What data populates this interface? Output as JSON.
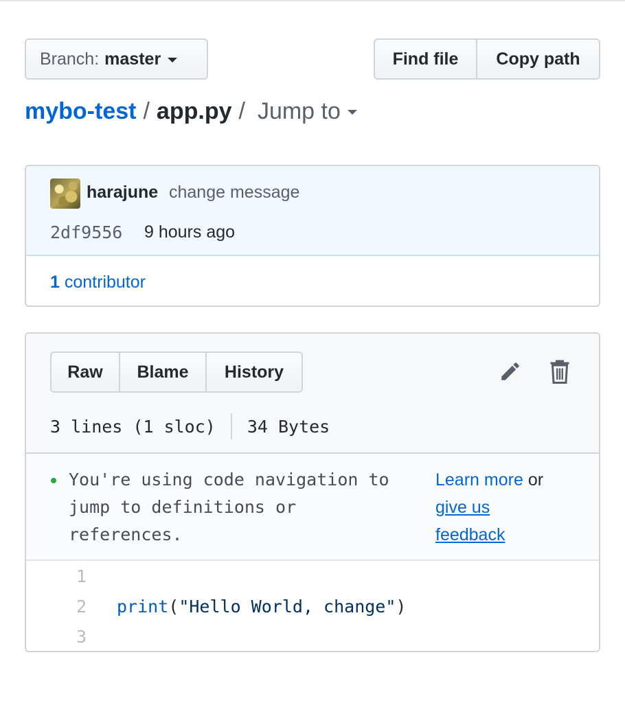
{
  "branch": {
    "prefix": "Branch:",
    "name": "master"
  },
  "file_actions": {
    "find_file": "Find file",
    "copy_path": "Copy path"
  },
  "breadcrumb": {
    "repo": "mybo-test",
    "separator": "/",
    "file": "app.py",
    "jump_to": "Jump to"
  },
  "commit": {
    "author": "harajune",
    "message": "change message",
    "sha": "2df9556",
    "time": "9 hours ago"
  },
  "contributors": {
    "count": "1",
    "label": "contributor"
  },
  "file_view": {
    "raw": "Raw",
    "blame": "Blame",
    "history": "History"
  },
  "file_info": {
    "lines": "3 lines (1 sloc)",
    "size": "34 Bytes"
  },
  "notice": {
    "text": "You're using code navigation to jump to definitions or references.",
    "learn_more": "Learn more",
    "or": "or",
    "give_us": "give us",
    "feedback": "feedback"
  },
  "code": {
    "lines": [
      {
        "num": "1",
        "text": ""
      },
      {
        "num": "2",
        "fn": "print",
        "open": "(",
        "str": "\"Hello World, change\"",
        "close": ")"
      },
      {
        "num": "3",
        "text": ""
      }
    ]
  },
  "colors": {
    "link": "#0366d6",
    "commit_bg": "#f1f8ff",
    "header_bg": "#f6f8fa",
    "dot": "#28a745"
  },
  "icons": {
    "edit": "pencil-icon",
    "delete": "trash-icon",
    "dropdown": "caret-down-icon"
  }
}
